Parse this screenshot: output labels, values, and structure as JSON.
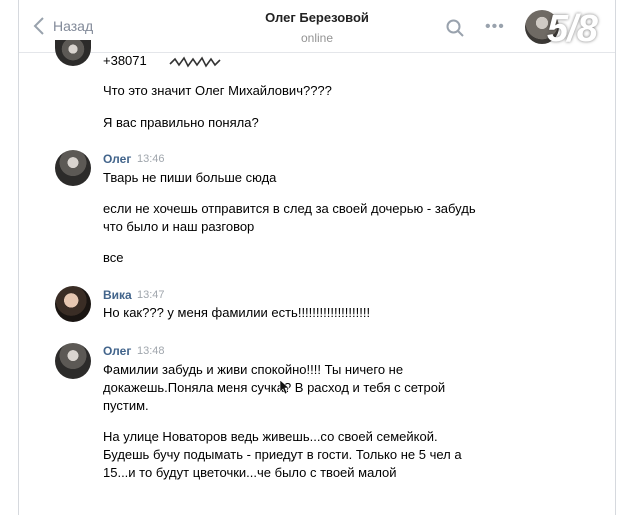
{
  "header": {
    "back_label": "Назад",
    "title": "Олег Березовой",
    "status": "online",
    "photo_counter": "5/8"
  },
  "messages": {
    "phone_partial": "+38071",
    "m1": "Что это значит Олег Михайлович????",
    "m2": "Я вас правильно поняла?",
    "oleg1": {
      "name": "Олег",
      "time": "13:46",
      "l1": "Тварь не пиши больше сюда",
      "l2": "если не хочешь отправится в след за своей дочерью - забудь",
      "l3": "что было и наш разговор",
      "l4": "все"
    },
    "vika": {
      "name": "Вика",
      "time": "13:47",
      "l1": "Но как??? у меня фамилии есть!!!!!!!!!!!!!!!!!!!!"
    },
    "oleg2": {
      "name": "Олег",
      "time": "13:48",
      "l1": "Фамилии забудь и живи спокойно!!!! Ты ничего не",
      "l2": "докажешь.Поняла меня сучка? В расход и тебя с сетрой",
      "l3": "пустим.",
      "l4": "На улице Новаторов ведь живешь...со своей семейкой.",
      "l5": "Будешь бучу подымать - приедут в гости. Только не 5 чел а",
      "l6": "15...и то будут цветочки...че было с твоей малой"
    }
  }
}
